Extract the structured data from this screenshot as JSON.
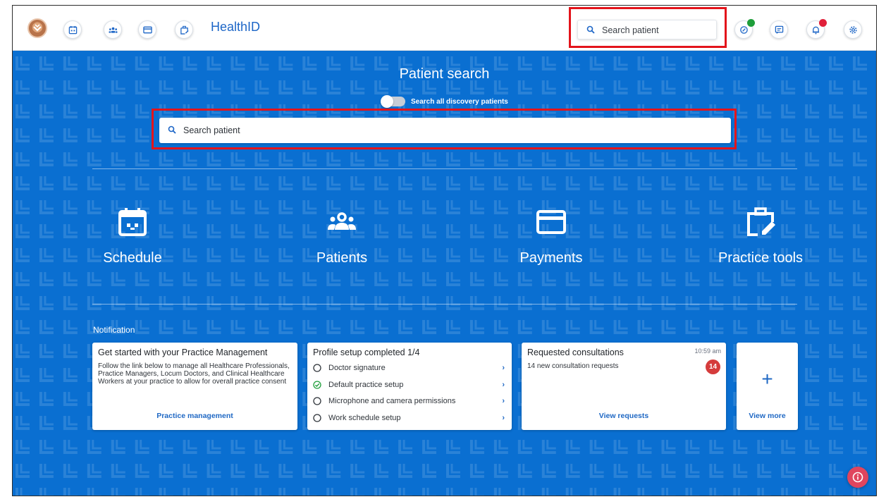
{
  "header": {
    "app_title": "HealthID",
    "search_placeholder": "Search patient",
    "nav_icons": [
      "calendar-icon",
      "patients-icon",
      "payments-icon",
      "practice-tools-icon"
    ],
    "right_icons": [
      "ai-assistant-icon",
      "messages-icon",
      "notifications-icon",
      "settings-icon"
    ]
  },
  "hero": {
    "title": "Patient search",
    "toggle_label": "Search all discovery patients",
    "search_placeholder": "Search patient"
  },
  "tiles": [
    {
      "label": "Schedule",
      "icon": "calendar-icon"
    },
    {
      "label": "Patients",
      "icon": "patients-icon"
    },
    {
      "label": "Payments",
      "icon": "credit-card-icon"
    },
    {
      "label": "Practice tools",
      "icon": "clipboard-edit-icon"
    }
  ],
  "notifications": {
    "heading": "Notification",
    "practice_card": {
      "title": "Get started with your Practice Management",
      "body": "Follow the link below to manage all Healthcare Professionals, Practice Managers, Locum Doctors, and Clinical Healthcare Workers at your practice to allow for overall practice consent",
      "link": "Practice management"
    },
    "profile_card": {
      "title": "Profile setup completed 1/4",
      "items": [
        {
          "label": "Doctor signature",
          "done": false
        },
        {
          "label": "Default practice setup",
          "done": true
        },
        {
          "label": "Microphone and camera permissions",
          "done": false
        },
        {
          "label": "Work schedule setup",
          "done": false
        }
      ]
    },
    "requests_card": {
      "title": "Requested consultations",
      "time": "10:59 am",
      "body": "14 new consultation requests",
      "badge": "14",
      "link": "View requests"
    },
    "more_card": {
      "plus": "+",
      "link": "View more"
    }
  },
  "colors": {
    "hero_background": "#0a6fd1",
    "accent": "#1f68c4",
    "highlight": "#e3141b",
    "badge_red": "#d53c3c",
    "status_green": "#1e9e3a"
  }
}
